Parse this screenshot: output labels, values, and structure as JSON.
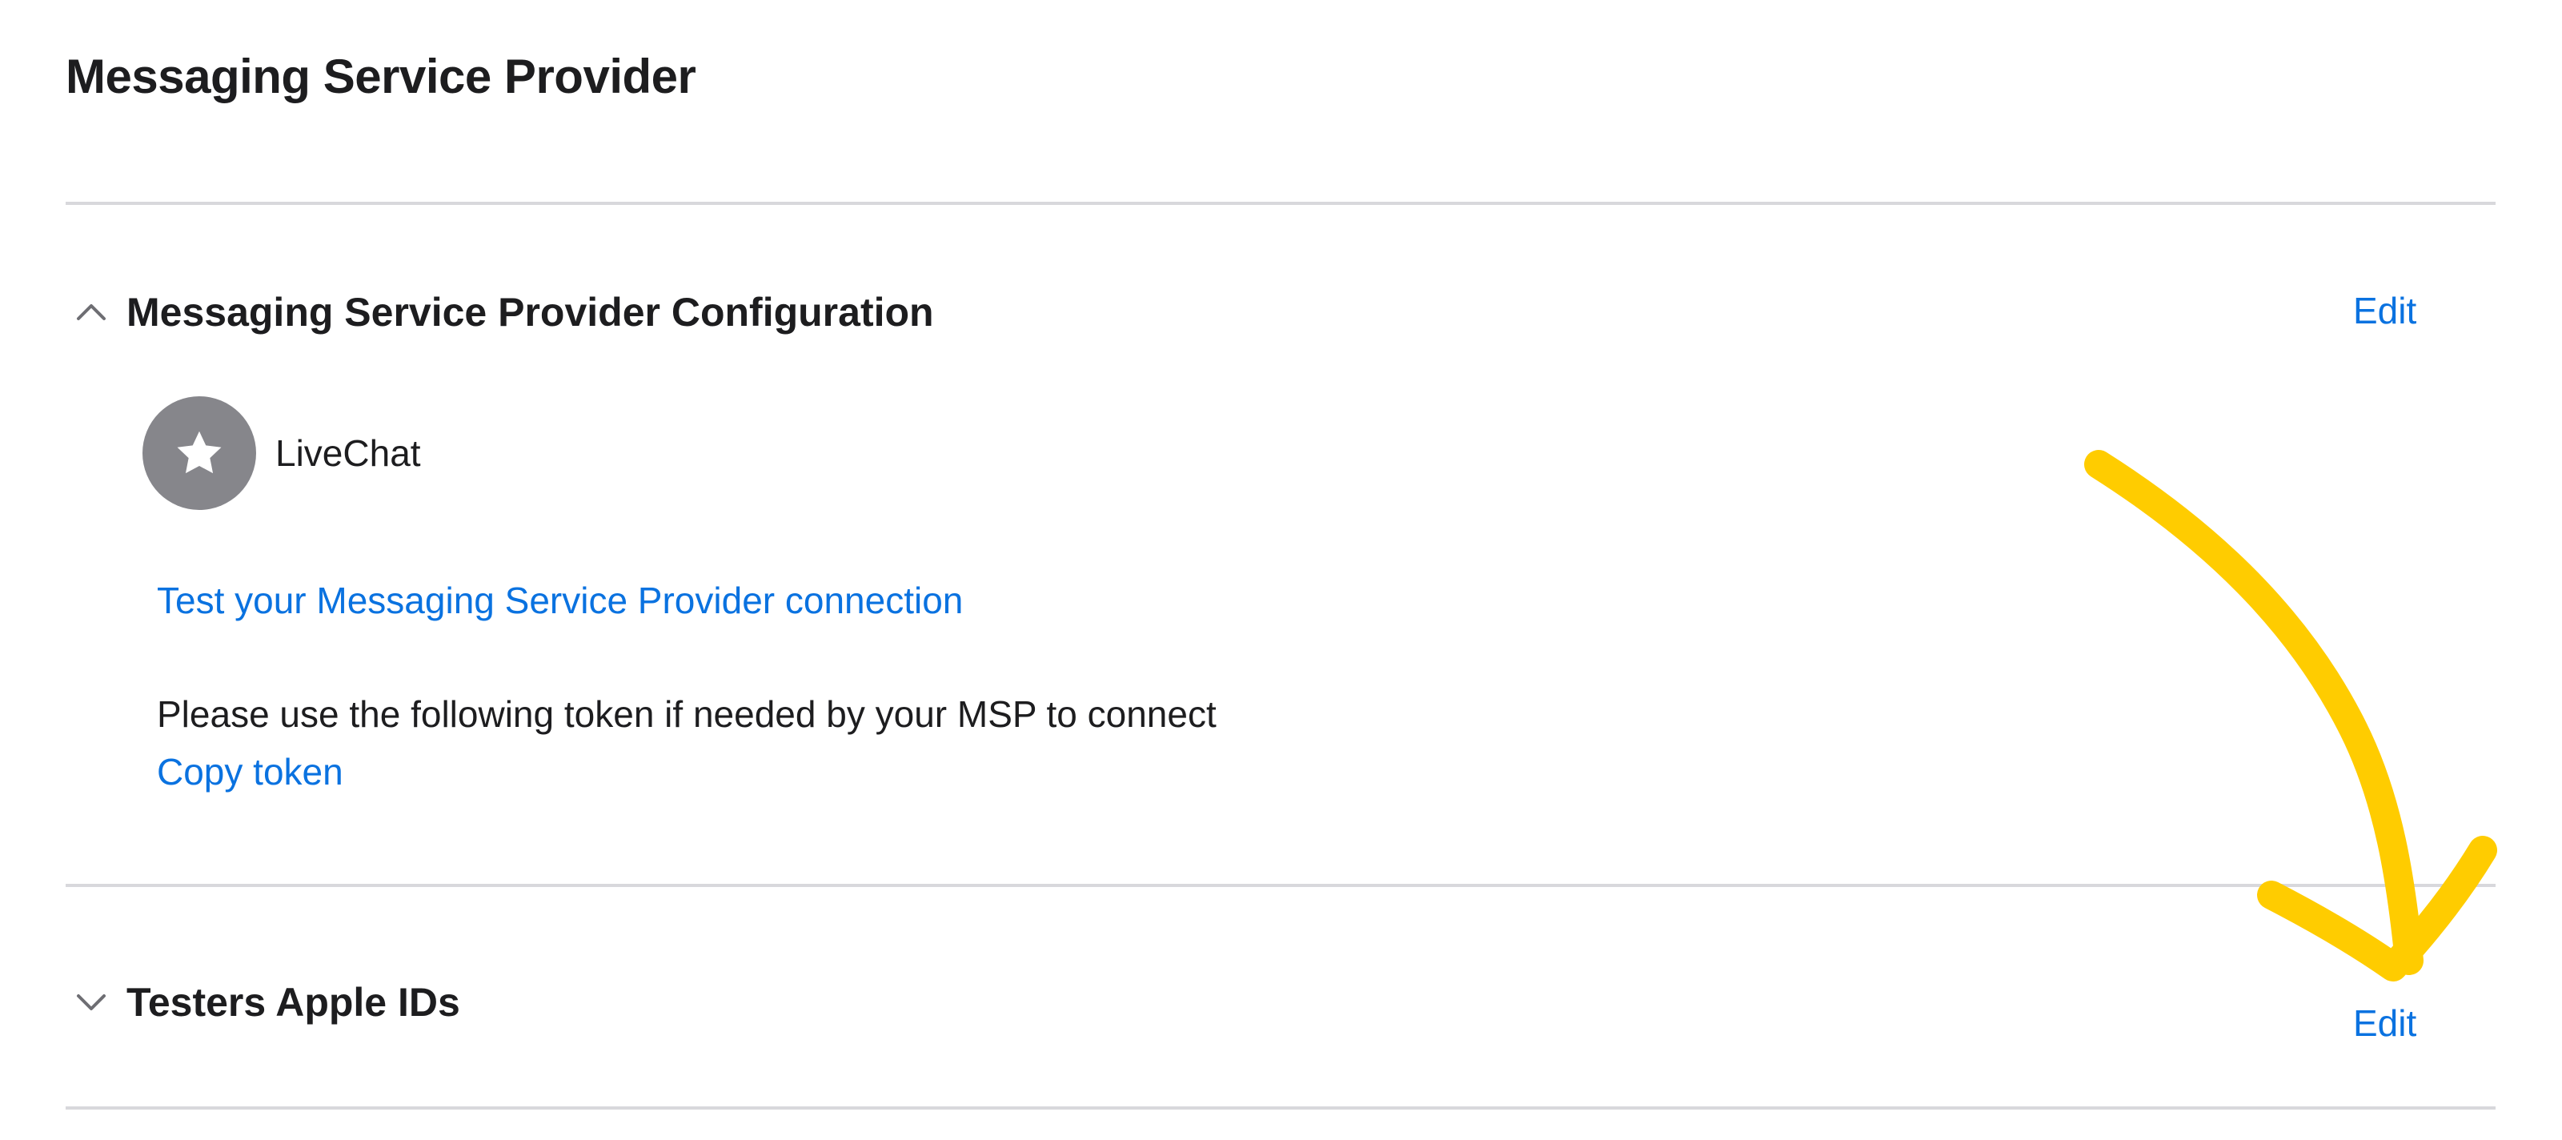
{
  "page": {
    "title": "Messaging Service Provider"
  },
  "config_section": {
    "title": "Messaging Service Provider Configuration",
    "edit_label": "Edit",
    "provider": {
      "name": "LiveChat",
      "avatar_icon": "star-icon"
    },
    "test_link": "Test your Messaging Service Provider connection",
    "token_text": "Please use the following token if needed by your MSP to connect",
    "copy_token_link": "Copy token",
    "expanded": true
  },
  "testers_section": {
    "title": "Testers Apple IDs",
    "edit_label": "Edit",
    "expanded": false
  },
  "colors": {
    "link": "#0a72e0",
    "text": "#1d1d1f",
    "divider": "#d8d8dc",
    "avatar": "#86868b",
    "annotation": "#ffcc00"
  }
}
